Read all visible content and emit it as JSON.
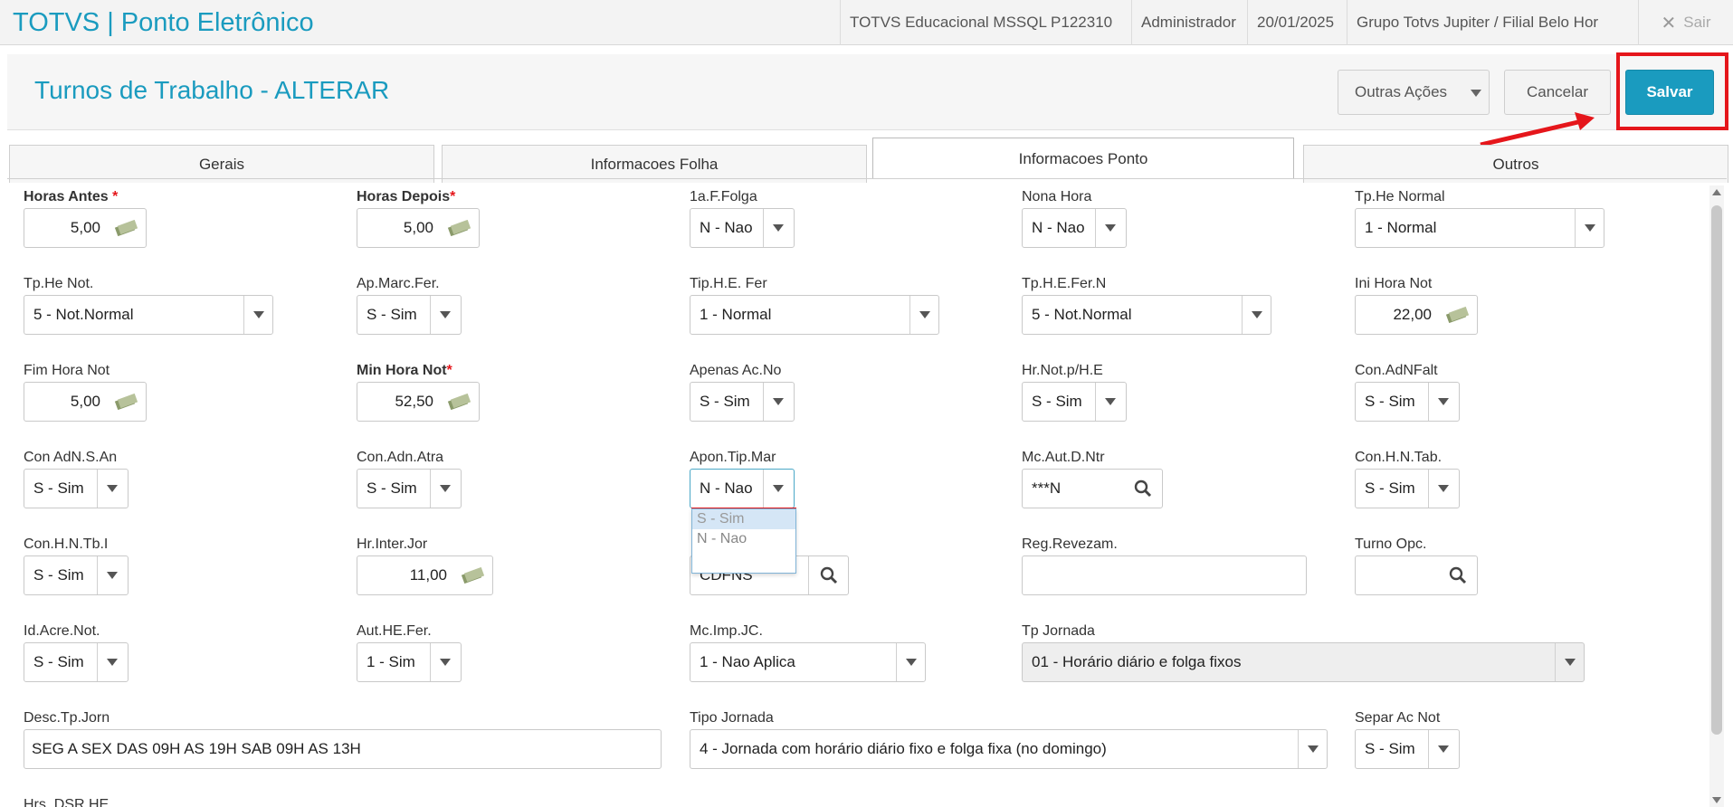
{
  "header": {
    "app_title": "TOTVS | Ponto Eletrônico",
    "environment": "TOTVS Educacional MSSQL P122310",
    "user": "Administrador",
    "date": "20/01/2025",
    "branch": "Grupo Totvs Jupiter / Filial Belo Hor",
    "exit_label": "Sair"
  },
  "page": {
    "title": "Turnos de Trabalho - ALTERAR",
    "other_actions_label": "Outras Ações",
    "cancel_label": "Cancelar",
    "save_label": "Salvar"
  },
  "tabs": [
    {
      "label": "Gerais",
      "active": false
    },
    {
      "label": "Informacoes Folha",
      "active": false
    },
    {
      "label": "Informacoes Ponto",
      "active": true
    },
    {
      "label": "Outros",
      "active": false
    }
  ],
  "fields": {
    "horas_antes": {
      "label": "Horas Antes ",
      "required": "*",
      "value": "5,00"
    },
    "horas_depois": {
      "label": "Horas Depois",
      "required": "*",
      "value": "5,00"
    },
    "primeira_folga": {
      "label": "1a.F.Folga",
      "value": "N - Nao"
    },
    "nona_hora": {
      "label": "Nona Hora",
      "value": "N - Nao"
    },
    "tp_he_normal": {
      "label": "Tp.He Normal",
      "value": "1 - Normal"
    },
    "tp_he_not": {
      "label": "Tp.He Not.",
      "value": "5 - Not.Normal"
    },
    "ap_marc_fer": {
      "label": "Ap.Marc.Fer.",
      "value": "S - Sim"
    },
    "tip_he_fer": {
      "label": "Tip.H.E. Fer",
      "value": "1 - Normal"
    },
    "tp_he_fer_n": {
      "label": "Tp.H.E.Fer.N",
      "value": "5 - Not.Normal"
    },
    "ini_hora_not": {
      "label": "Ini Hora Not",
      "value": "22,00"
    },
    "fim_hora_not": {
      "label": "Fim Hora Not",
      "value": "5,00"
    },
    "min_hora_not": {
      "label": "Min Hora Not",
      "required": "*",
      "value": "52,50"
    },
    "apenas_ac_no": {
      "label": "Apenas Ac.No",
      "value": "S - Sim"
    },
    "hr_not_p_he": {
      "label": "Hr.Not.p/H.E",
      "value": "S - Sim"
    },
    "con_adnfalt": {
      "label": "Con.AdNFalt",
      "value": "S - Sim"
    },
    "con_adn_s_an": {
      "label": "Con AdN.S.An",
      "value": "S - Sim"
    },
    "con_adn_atra": {
      "label": "Con.Adn.Atra",
      "value": "S - Sim"
    },
    "apon_tip_mar": {
      "label": "Apon.Tip.Mar",
      "value": "N - Nao"
    },
    "mc_aut_d_ntr": {
      "label": "Mc.Aut.D.Ntr",
      "value": "***N"
    },
    "con_hn_tab": {
      "label": "Con.H.N.Tab.",
      "value": "S - Sim"
    },
    "con_hn_tb_i": {
      "label": "Con.H.N.Tb.I",
      "value": "S - Sim"
    },
    "hr_inter_jor": {
      "label": "Hr.Inter.Jor",
      "value": "11,00"
    },
    "hidden_lookup": {
      "value": "CDFNS"
    },
    "reg_revezam": {
      "label": "Reg.Revezam.",
      "value": ""
    },
    "turno_opc": {
      "label": "Turno Opc.",
      "value": ""
    },
    "id_acre_not": {
      "label": "Id.Acre.Not.",
      "value": "S - Sim"
    },
    "aut_he_fer": {
      "label": "Aut.HE.Fer.",
      "value": "1 - Sim"
    },
    "mc_imp_jc": {
      "label": "Mc.Imp.JC.",
      "value": "1 - Nao Aplica"
    },
    "tp_jornada": {
      "label": "Tp Jornada",
      "value": "01 - Horário diário e folga fixos"
    },
    "desc_tp_jorn": {
      "label": "Desc.Tp.Jorn",
      "value": "SEG A SEX DAS 09H AS 19H SAB 09H AS 13H"
    },
    "tipo_jornada": {
      "label": "Tipo Jornada",
      "value": "4 - Jornada com horário diário fixo e folga fixa (no domingo)"
    },
    "separ_ac_not": {
      "label": "Separ Ac Not",
      "value": "S - Sim"
    },
    "hrs_dsr_he": {
      "label": "Hrs. DSR HE"
    }
  },
  "dropdown_open": {
    "options": [
      "S - Sim",
      "N - Nao"
    ],
    "highlighted": "S - Sim"
  },
  "colors": {
    "accent": "#1a9bbf",
    "annotation_red": "#e5161b"
  }
}
